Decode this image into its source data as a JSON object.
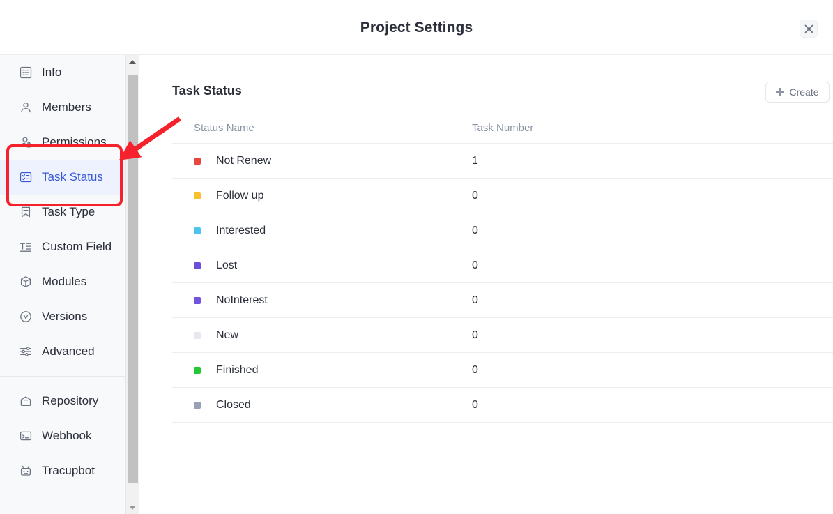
{
  "modal": {
    "title": "Project Settings",
    "close_label": "Close",
    "close_icon": "close-icon"
  },
  "sidebar": {
    "groups": [
      {
        "items": [
          {
            "label": "Info",
            "icon": "list-box-icon",
            "active": false
          },
          {
            "label": "Members",
            "icon": "user-icon",
            "active": false
          },
          {
            "label": "Permissions",
            "icon": "user-lock-icon",
            "active": false
          },
          {
            "label": "Task Status",
            "icon": "task-status-icon",
            "active": true
          },
          {
            "label": "Task Type",
            "icon": "bookmark-icon",
            "active": false
          },
          {
            "label": "Custom Field",
            "icon": "text-field-icon",
            "active": false
          },
          {
            "label": "Modules",
            "icon": "cube-icon",
            "active": false
          },
          {
            "label": "Versions",
            "icon": "version-circle-icon",
            "active": false
          },
          {
            "label": "Advanced",
            "icon": "sliders-icon",
            "active": false
          }
        ]
      },
      {
        "items": [
          {
            "label": "Repository",
            "icon": "repository-icon",
            "active": false
          },
          {
            "label": "Webhook",
            "icon": "terminal-window-icon",
            "active": false
          },
          {
            "label": "Tracupbot",
            "icon": "robot-icon",
            "active": false
          }
        ]
      }
    ],
    "scrollbar": {
      "up_icon": "chevron-up-icon",
      "down_icon": "chevron-down-icon"
    }
  },
  "main": {
    "section_title": "Task Status",
    "create_button": {
      "label": "Create",
      "icon": "plus-icon"
    },
    "table": {
      "columns": [
        "Status Name",
        "Task Number"
      ],
      "rows": [
        {
          "color": "#e8463f",
          "name": "Not Renew",
          "tasks": "1"
        },
        {
          "color": "#fbc02d",
          "name": "Follow up",
          "tasks": "0"
        },
        {
          "color": "#4cc3f0",
          "name": "Interested",
          "tasks": "0"
        },
        {
          "color": "#6f4ddb",
          "name": "Lost",
          "tasks": "0"
        },
        {
          "color": "#7153de",
          "name": "NoInterest",
          "tasks": "0"
        },
        {
          "color": "#e5e8ef",
          "name": "New",
          "tasks": "0"
        },
        {
          "color": "#22c935",
          "name": "Finished",
          "tasks": "0"
        },
        {
          "color": "#98a1b5",
          "name": "Closed",
          "tasks": "0"
        }
      ]
    }
  },
  "annotations": {
    "highlight_color": "#f5222d",
    "arrow_color": "#f5222d",
    "target": "Task Status"
  }
}
